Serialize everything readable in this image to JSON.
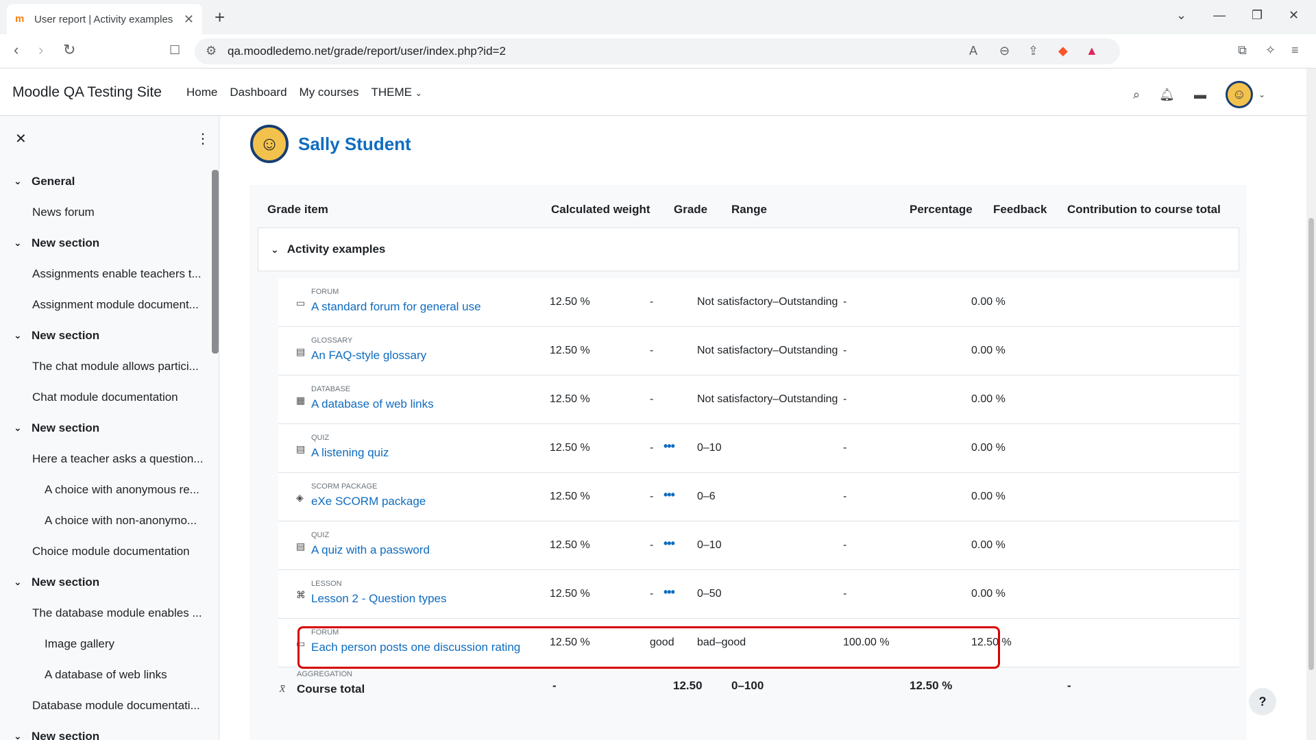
{
  "browser": {
    "tab_title": "User report | Activity examples",
    "url": "qa.moodledemo.net/grade/report/user/index.php?id=2"
  },
  "navbar": {
    "site_name": "Moodle QA Testing Site",
    "links": [
      "Home",
      "Dashboard",
      "My courses",
      "THEME"
    ]
  },
  "drawer": {
    "items": [
      {
        "type": "section",
        "label": "General"
      },
      {
        "type": "act",
        "label": "News forum"
      },
      {
        "type": "section",
        "label": "New section"
      },
      {
        "type": "act",
        "label": "Assignments enable teachers t..."
      },
      {
        "type": "act",
        "label": "Assignment module document..."
      },
      {
        "type": "section",
        "label": "New section"
      },
      {
        "type": "act",
        "label": "The chat module allows partici..."
      },
      {
        "type": "act",
        "label": "Chat module documentation"
      },
      {
        "type": "section",
        "label": "New section"
      },
      {
        "type": "act",
        "label": "Here a teacher asks a question..."
      },
      {
        "type": "sub",
        "label": "A choice with anonymous re..."
      },
      {
        "type": "sub",
        "label": "A choice with non-anonymo..."
      },
      {
        "type": "act",
        "label": "Choice module documentation"
      },
      {
        "type": "section",
        "label": "New section"
      },
      {
        "type": "act",
        "label": "The database module enables ..."
      },
      {
        "type": "sub",
        "label": "Image gallery"
      },
      {
        "type": "sub",
        "label": "A database of web links"
      },
      {
        "type": "act",
        "label": "Database module documentati..."
      },
      {
        "type": "section",
        "label": "New section"
      }
    ]
  },
  "user": {
    "name": "Sally Student"
  },
  "report": {
    "headers": {
      "grade_item": "Grade item",
      "weight": "Calculated weight",
      "grade": "Grade",
      "range": "Range",
      "percentage": "Percentage",
      "feedback": "Feedback",
      "contribution": "Contribution to course total"
    },
    "category": "Activity examples",
    "rows": [
      {
        "icon": "forum-icon",
        "glyph": "▭",
        "module": "FORUM",
        "name": "A standard forum for general use",
        "weight": "12.50 %",
        "grade": "-",
        "more": false,
        "range": "Not satisfactory–Outstanding",
        "percentage": "-",
        "contribution": "0.00 %"
      },
      {
        "icon": "glossary-icon",
        "glyph": "▤",
        "module": "GLOSSARY",
        "name": "An FAQ-style glossary",
        "weight": "12.50 %",
        "grade": "-",
        "more": false,
        "range": "Not satisfactory–Outstanding",
        "percentage": "-",
        "contribution": "0.00 %"
      },
      {
        "icon": "database-icon",
        "glyph": "▦",
        "module": "DATABASE",
        "name": "A database of web links",
        "weight": "12.50 %",
        "grade": "-",
        "more": false,
        "range": "Not satisfactory–Outstanding",
        "percentage": "-",
        "contribution": "0.00 %"
      },
      {
        "icon": "quiz-icon",
        "glyph": "▤",
        "module": "QUIZ",
        "name": "A listening quiz",
        "weight": "12.50 %",
        "grade": "-",
        "more": true,
        "range": "0–10",
        "percentage": "-",
        "contribution": "0.00 %"
      },
      {
        "icon": "scorm-icon",
        "glyph": "◈",
        "module": "SCORM PACKAGE",
        "name": "eXe SCORM package",
        "weight": "12.50 %",
        "grade": "-",
        "more": true,
        "range": "0–6",
        "percentage": "-",
        "contribution": "0.00 %"
      },
      {
        "icon": "quiz-icon",
        "glyph": "▤",
        "module": "QUIZ",
        "name": "A quiz with a password",
        "weight": "12.50 %",
        "grade": "-",
        "more": true,
        "range": "0–10",
        "percentage": "-",
        "contribution": "0.00 %"
      },
      {
        "icon": "lesson-icon",
        "glyph": "⌘",
        "module": "LESSON",
        "name": "Lesson 2 - Question types",
        "weight": "12.50 %",
        "grade": "-",
        "more": true,
        "range": "0–50",
        "percentage": "-",
        "contribution": "0.00 %"
      },
      {
        "icon": "forum-icon",
        "glyph": "▭",
        "module": "FORUM",
        "name": "Each person posts one discussion rating",
        "weight": "12.50 %",
        "grade": "good",
        "more": false,
        "range": "bad–good",
        "percentage": "100.00 %",
        "contribution": "12.50 %"
      }
    ],
    "total": {
      "module": "AGGREGATION",
      "name": "Course total",
      "weight": "-",
      "grade": "12.50",
      "range": "0–100",
      "percentage": "12.50 %",
      "contribution": "-"
    }
  },
  "help": "?"
}
